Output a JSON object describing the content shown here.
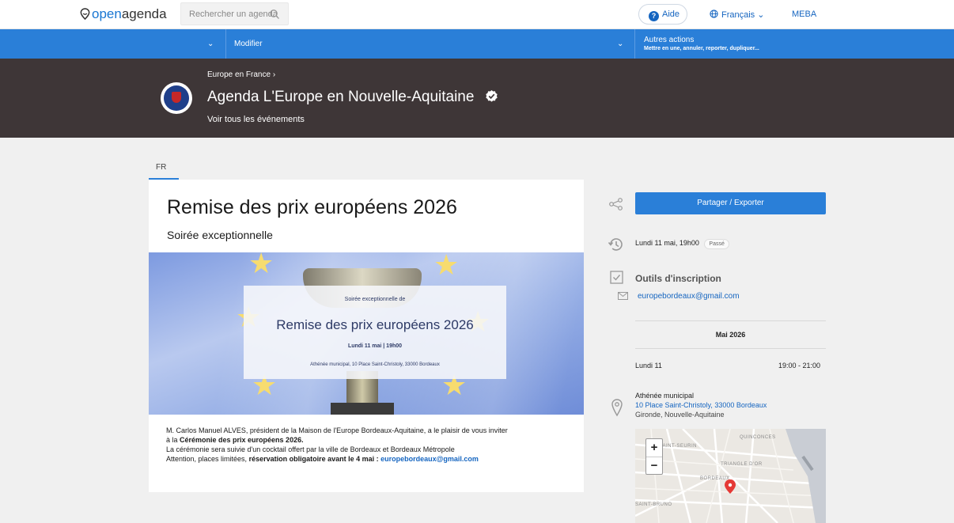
{
  "topbar": {
    "logo_prefix": "open",
    "logo_suffix": "agenda",
    "search_placeholder": "Rechercher un agenda",
    "help_label": "Aide",
    "language_label": "Français",
    "user_label": "MEBA"
  },
  "actionbar": {
    "modify_label": "Modifier",
    "other_actions_label": "Autres actions",
    "other_actions_sub": "Mettre en une, annuler, reporter, dupliquer..."
  },
  "agenda_header": {
    "breadcrumb": "Europe en France ›",
    "title": "Agenda L'Europe en Nouvelle-Aquitaine",
    "see_all_label": "Voir tous les événements"
  },
  "tabs": [
    {
      "label": "FR"
    }
  ],
  "event": {
    "title": "Remise des prix européens 2026",
    "subtitle": "Soirée exceptionnelle",
    "banner": {
      "small_line": "Soirée exceptionnelle de",
      "big_line": "Remise des prix européens 2026",
      "date_line": "Lundi 11 mai | 19h00",
      "address_line": "Athénée municipal, 10 Place Saint-Christoly, 33000 Bordeaux"
    },
    "description": {
      "line1": "M. Carlos Manuel ALVES, président de la Maison de l'Europe Bordeaux-Aquitaine, a le plaisir de vous inviter",
      "line2_prefix": "à la ",
      "line2_bold": "Cérémonie des prix européens 2026.",
      "line3": "La cérémonie sera suivie d'un cocktail offert par la ville de Bordeaux et Bordeaux Métropole",
      "line4_prefix": "Attention, places limitées, ",
      "line4_bold": "réservation obligatoire avant le 4 mai : ",
      "line4_email": "europebordeaux@gmail.com"
    }
  },
  "sidebar": {
    "share_label": "Partager / Exporter",
    "date_label": "Lundi 11 mai, 19h00",
    "status_badge": "Passé",
    "tools_heading": "Outils d'inscription",
    "tools_email": "europebordeaux@gmail.com",
    "month_label": "Mai 2026",
    "day_label": "Lundi 11",
    "hours_label": "19:00 - 21:00",
    "venue_name": "Athénée municipal",
    "venue_address": "10 Place Saint-Christoly, 33000 Bordeaux",
    "venue_region": "Gironde, Nouvelle-Aquitaine"
  },
  "map": {
    "zoom_in": "+",
    "zoom_out": "−",
    "labels": {
      "quinconces": "QUINCONCES",
      "saint_seurin": "SAINT-SEURIN",
      "triangle": "TRIANGLE D'OR",
      "bordeaux": "BORDEAUX",
      "saint_bruno": "SAINT-BRUNO"
    }
  },
  "colors": {
    "accent_blue": "#2a7fd8",
    "header_dark": "#3e3637",
    "link_blue": "#1565c0",
    "map_marker": "#e53935"
  }
}
